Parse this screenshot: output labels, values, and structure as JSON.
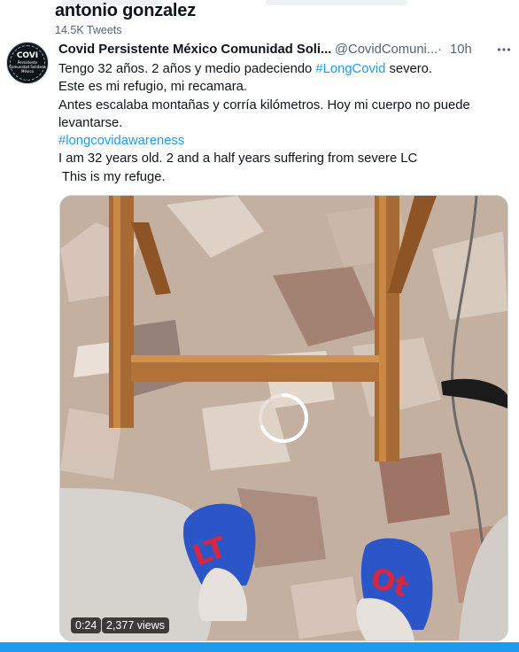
{
  "profile": {
    "name": "antonio gonzalez",
    "tweet_count": "14.5K Tweets"
  },
  "tweet": {
    "avatar_text_main": "COVI",
    "avatar_text_sub": "Persistente Comunidad Solidaria México",
    "author_name": "Covid Persistente México Comunidad Soli...",
    "author_handle": "@CovidComuni...",
    "separator": "·",
    "time": "10h",
    "more_icon": "more-horizontal-icon",
    "line1_prefix": "Tengo 32 años. 2 años y medio padeciendo ",
    "hashtag_longcovid": "#LongCovid",
    "line1_suffix": " severo.",
    "line2": "Este es mi refugio, mi recamara.",
    "line3": "Antes escalaba montañas y corría kilómetros. Hoy mi cuerpo no puede",
    "line4": "levantarse.",
    "hashtag_awareness": "#longcovidawareness",
    "line6": "I am 32 years old.  2 and a half years suffering from severe LC",
    "line7": " This is my refuge."
  },
  "video": {
    "duration": "0:24",
    "views": "2,377 views",
    "spinner_icon": "loading-spinner-icon",
    "colors": {
      "floor": "#c5b1a2",
      "wood": "#a86a34",
      "slipper": "#2c56c8",
      "slipper_text": "#d7263d"
    }
  },
  "colors": {
    "accent": "#1d9bf0",
    "secondary_text": "#536471",
    "primary_text": "#0f1419"
  }
}
